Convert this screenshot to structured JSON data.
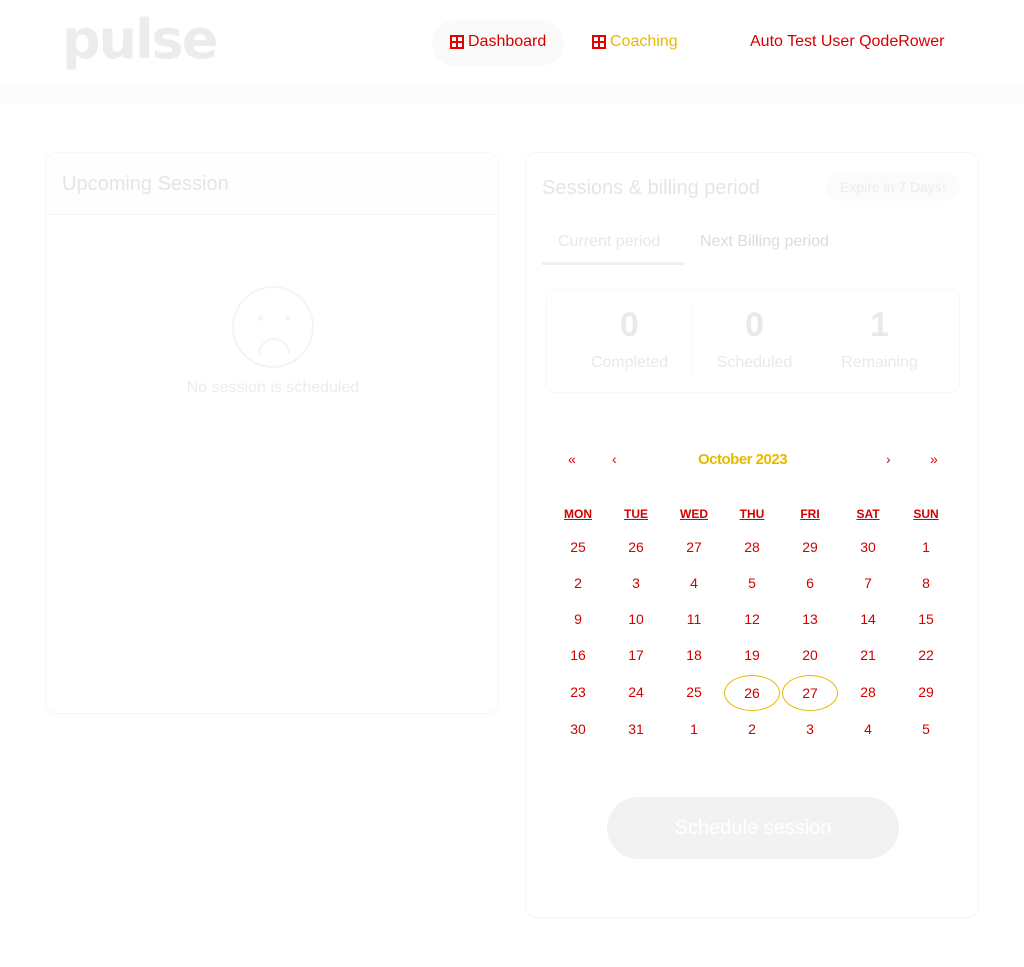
{
  "brand": {
    "logo": "pulse"
  },
  "nav": {
    "items": [
      {
        "label": "Dashboard",
        "icon": "grid-icon"
      },
      {
        "label": "Coaching",
        "icon": "coaching-icon"
      },
      {
        "label": "Auto Test User QodeRower",
        "icon": "user-icon"
      }
    ]
  },
  "upcoming": {
    "title": "Upcoming Session",
    "empty_text": "No session is scheduled",
    "empty_icon": "sad-face-icon"
  },
  "billing": {
    "title": "Sessions & billing period",
    "badge": "Expire in 7 Days!",
    "tabs": [
      {
        "label": "Current period",
        "active": true
      },
      {
        "label": "Next Billing period",
        "active": false
      }
    ],
    "stats": [
      {
        "value": "0",
        "label": "Completed"
      },
      {
        "value": "0",
        "label": "Scheduled"
      },
      {
        "value": "1",
        "label": "Remaining"
      }
    ],
    "calendar": {
      "month_label": "October 2023",
      "prev_year": "«",
      "prev_month": "‹",
      "next_month": "›",
      "next_year": "»",
      "weekdays": [
        "MON",
        "TUE",
        "WED",
        "THU",
        "FRI",
        "SAT",
        "SUN"
      ],
      "weeks": [
        [
          "25",
          "26",
          "27",
          "28",
          "29",
          "30",
          "1"
        ],
        [
          "2",
          "3",
          "4",
          "5",
          "6",
          "7",
          "8"
        ],
        [
          "9",
          "10",
          "11",
          "12",
          "13",
          "14",
          "15"
        ],
        [
          "16",
          "17",
          "18",
          "19",
          "20",
          "21",
          "22"
        ],
        [
          "23",
          "24",
          "25",
          "26",
          "27",
          "28",
          "29"
        ],
        [
          "30",
          "31",
          "1",
          "2",
          "3",
          "4",
          "5"
        ]
      ],
      "highlighted": [
        "26",
        "27"
      ]
    },
    "schedule_button": "Schedule session"
  }
}
